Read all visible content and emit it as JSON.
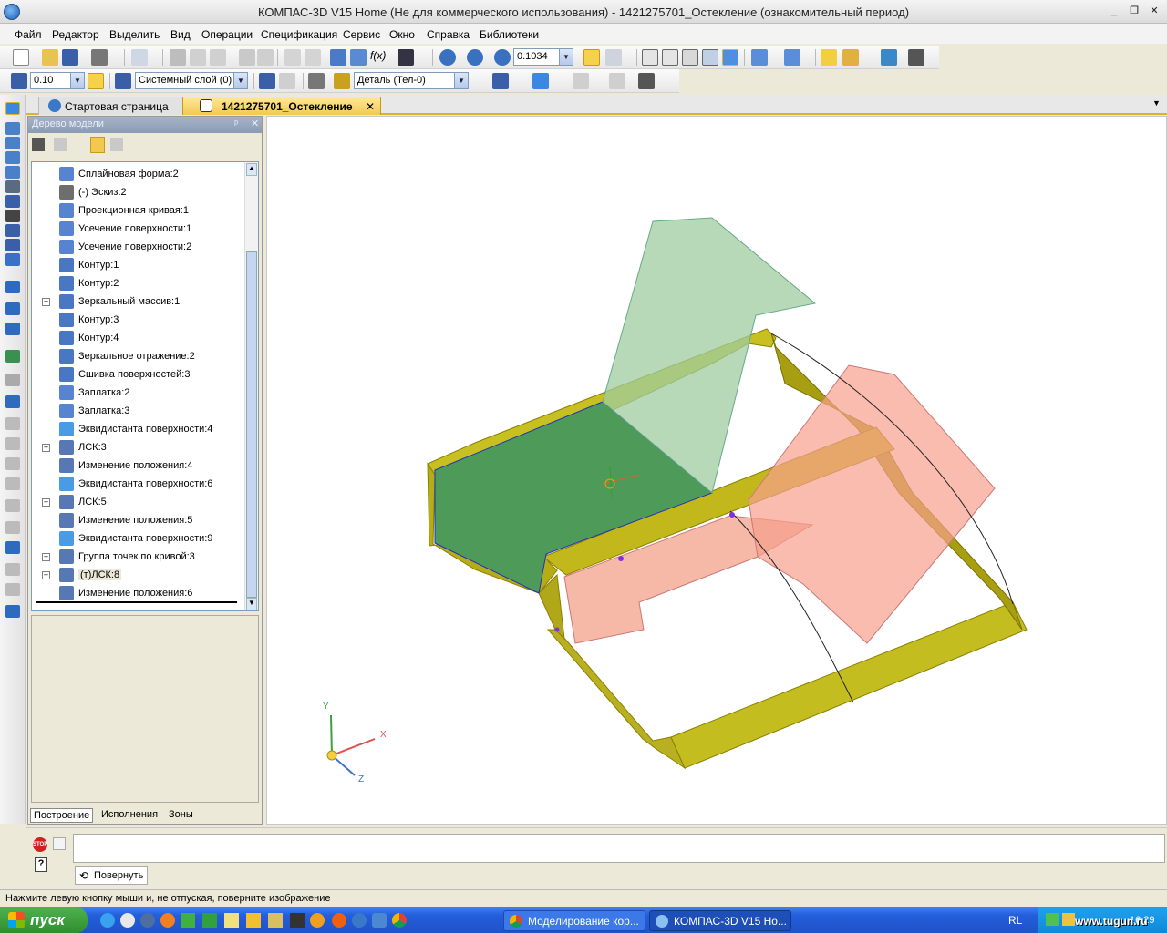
{
  "window": {
    "title": "КОМПАС-3D V15 Home (Не для коммерческого использования) - 1421275701_Остекление (ознакомительный период)",
    "controls": [
      "_",
      "❐",
      "✕"
    ]
  },
  "menu": [
    "Файл",
    "Редактор",
    "Выделить",
    "Вид",
    "Операции",
    "Спецификация",
    "Сервис",
    "Окно",
    "Справка",
    "Библиотеки"
  ],
  "toolbar1": {
    "fx_label": "f(x)",
    "zoom_value": "0.1034"
  },
  "toolbar2": {
    "step_value": "0.10",
    "layer_value": "Системный слой (0)",
    "part_value": "Деталь (Тел-0)"
  },
  "tabs": [
    {
      "label": "Стартовая страница"
    },
    {
      "label": "1421275701_Остекление",
      "close": "✕"
    }
  ],
  "tree_panel": {
    "title": "Дерево модели",
    "pin": "ᵖ",
    "close": "✕",
    "items": [
      {
        "label": "Сплайновая форма:2",
        "expand": ""
      },
      {
        "label": "(-) Эскиз:2",
        "expand": ""
      },
      {
        "label": "Проекционная кривая:1",
        "expand": ""
      },
      {
        "label": "Усечение поверхности:1",
        "expand": ""
      },
      {
        "label": "Усечение поверхности:2",
        "expand": ""
      },
      {
        "label": "Контур:1",
        "expand": ""
      },
      {
        "label": "Контур:2",
        "expand": ""
      },
      {
        "label": "Зеркальный массив:1",
        "expand": "+"
      },
      {
        "label": "Контур:3",
        "expand": ""
      },
      {
        "label": "Контур:4",
        "expand": ""
      },
      {
        "label": "Зеркальное отражение:2",
        "expand": ""
      },
      {
        "label": "Сшивка поверхностей:3",
        "expand": ""
      },
      {
        "label": "Заплатка:2",
        "expand": ""
      },
      {
        "label": "Заплатка:3",
        "expand": ""
      },
      {
        "label": "Эквидистанта поверхности:4",
        "expand": ""
      },
      {
        "label": "ЛСК:3",
        "expand": "+"
      },
      {
        "label": "Изменение положения:4",
        "expand": ""
      },
      {
        "label": "Эквидистанта поверхности:6",
        "expand": ""
      },
      {
        "label": "ЛСК:5",
        "expand": "+"
      },
      {
        "label": "Изменение положения:5",
        "expand": ""
      },
      {
        "label": "Эквидистанта поверхности:9",
        "expand": ""
      },
      {
        "label": "Группа точек по кривой:3",
        "expand": "+"
      },
      {
        "label": "(т)ЛСК:8",
        "expand": "+"
      },
      {
        "label": "Изменение положения:6",
        "expand": ""
      }
    ],
    "bottom_tabs": [
      "Построение",
      "Исполнения",
      "Зоны"
    ]
  },
  "viewport": {
    "axes": {
      "x": "X",
      "y": "Y",
      "z": "Z"
    }
  },
  "command_panel": {
    "stop_label": "STOP",
    "help_label": "?",
    "rotate_label": "Повернуть"
  },
  "status_text": "Нажмите левую кнопку мыши и, не отпуская, поверните изображение",
  "taskbar": {
    "start_label": "пуск",
    "tasks": [
      "Моделирование кор...",
      "КОМПАС-3D V15 Ho..."
    ],
    "lang": "RL",
    "clock": "16:29",
    "watermark": "www.tugun.ru"
  },
  "colors": {
    "accent_tab": "#e0b030",
    "model_olive": "#b8b018",
    "glass_green": "#4a9a5a",
    "glass_pink": "#f6a08c"
  }
}
